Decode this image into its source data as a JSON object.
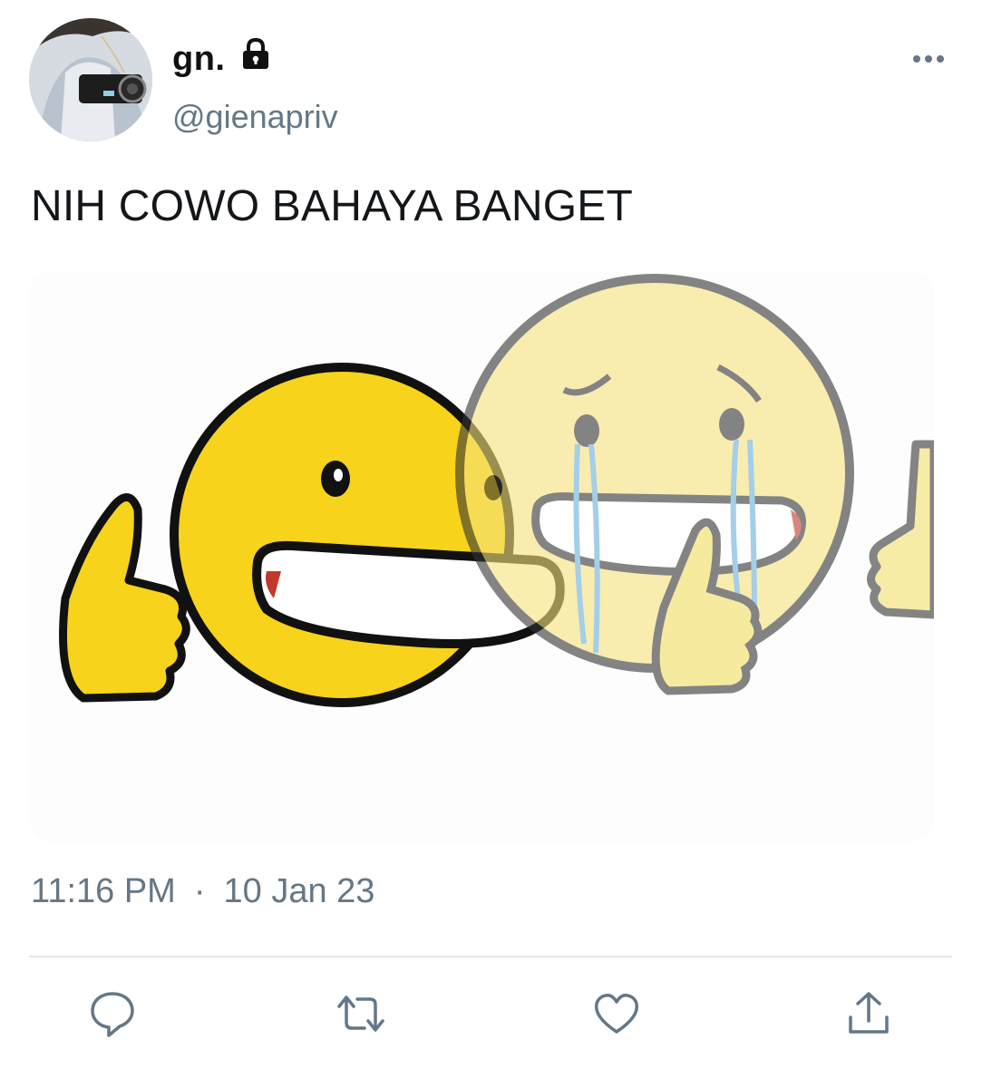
{
  "user": {
    "display_name": "gn.",
    "handle": "@gienapriv",
    "protected": true,
    "avatar_icon": "profile-photo",
    "lock_icon": "lock-icon"
  },
  "tweet": {
    "text": "NIH COWO BAHAYA BANGET",
    "time": "11:16 PM",
    "separator": "·",
    "date": "10 Jan 23"
  },
  "actions": [
    {
      "name": "reply",
      "icon": "speech-bubble-icon"
    },
    {
      "name": "retweet",
      "icon": "retweet-arrows-icon"
    },
    {
      "name": "like",
      "icon": "heart-icon"
    },
    {
      "name": "share",
      "icon": "share-upload-icon"
    }
  ],
  "colors": {
    "text": "#14171a",
    "secondary": "#657786",
    "divider": "#e1e8ed",
    "emoji_yellow": "#f7d31b",
    "emoji_faded": "#f8ea8f"
  }
}
